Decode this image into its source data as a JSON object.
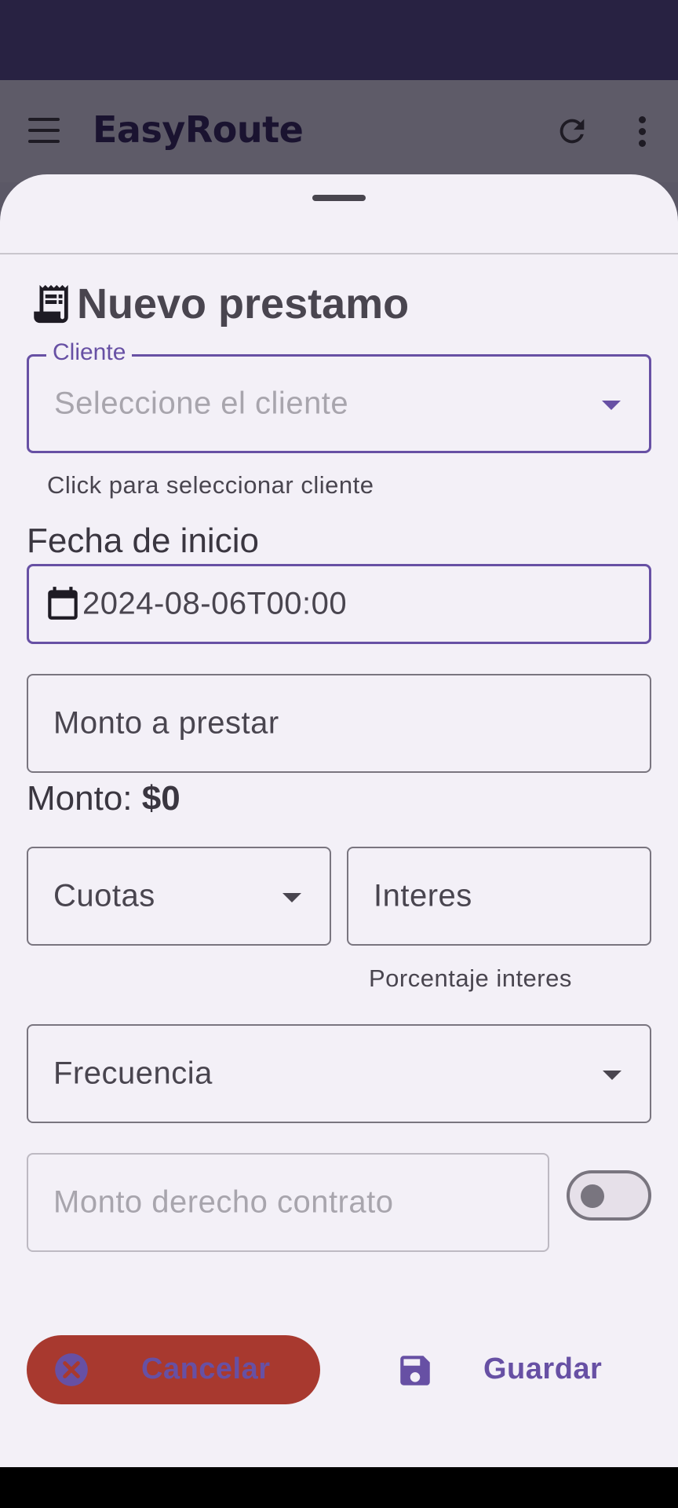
{
  "app": {
    "title": "EasyRoute"
  },
  "sheet": {
    "heading": "Nuevo prestamo"
  },
  "cliente": {
    "label": "Cliente",
    "placeholder": "Seleccione el cliente",
    "helper": "Click para seleccionar cliente"
  },
  "fecha": {
    "label": "Fecha de inicio",
    "value": "2024-08-06T00:00"
  },
  "monto": {
    "placeholder": "Monto a prestar",
    "summary_label": "Monto:",
    "summary_value": "$0"
  },
  "cuotas": {
    "label": "Cuotas"
  },
  "interes": {
    "label": "Interes",
    "helper": "Porcentaje interes"
  },
  "frecuencia": {
    "label": "Frecuencia"
  },
  "contrato": {
    "placeholder": "Monto derecho contrato",
    "toggle_on": false
  },
  "actions": {
    "cancel_label": "Cancelar",
    "save_label": "Guardar"
  },
  "colors": {
    "primary": "#6750a4",
    "cancel_bg": "#a8392f",
    "status_bar": "#282242",
    "sheet_bg": "#f3f0f7"
  },
  "icons": [
    "menu-icon",
    "refresh-icon",
    "more-vert-icon",
    "receipt-icon",
    "calendar-icon",
    "close-circle-icon",
    "save-icon"
  ]
}
